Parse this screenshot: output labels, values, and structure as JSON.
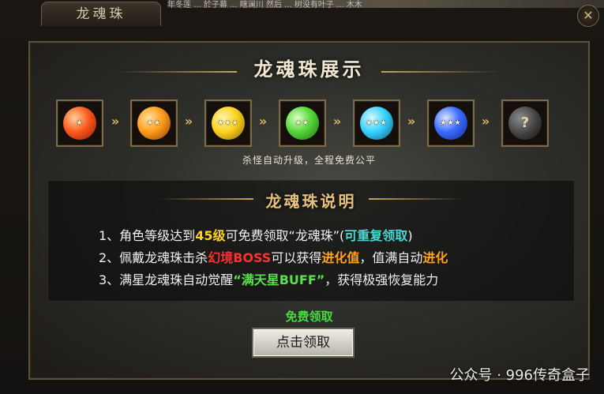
{
  "window": {
    "title": "龙魂珠"
  },
  "top_strip": {
    "text": "年冬莲 ... 於子幕 ... 瞎澜川 然后 ... 树没有叶子 ... 木木"
  },
  "showcase": {
    "title": "龙魂珠展示",
    "caption": "杀怪自动升级，全程免费公平",
    "orbs": [
      {
        "name": "red-orb-icon",
        "color": "#ff5a1f"
      },
      {
        "name": "orange-orb-icon",
        "color": "#ff9d1a"
      },
      {
        "name": "yellow-orb-icon",
        "color": "#ffd21f"
      },
      {
        "name": "green-orb-icon",
        "color": "#56d839"
      },
      {
        "name": "cyan-orb-icon",
        "color": "#38d3ff"
      },
      {
        "name": "blue-orb-icon",
        "color": "#3b6bff"
      },
      {
        "name": "unknown-orb-icon",
        "color": "#4a4a4a",
        "label": "?"
      }
    ]
  },
  "description": {
    "title": "龙魂珠说明",
    "line1": {
      "a": "1、角色等级达到",
      "b": "45级",
      "c": "可免费领取“龙魂珠”(",
      "d": "可重复领取",
      "e": ")"
    },
    "line2": {
      "a": "2、佩戴龙魂珠击杀",
      "b": "幻境BOSS",
      "c": "可以获得",
      "d": "进化值",
      "e": "，值满自动",
      "f": "进化"
    },
    "line3": {
      "a": "3、满星龙魂珠自动觉醒",
      "b": "“满天星BUFF”",
      "c": "，获得极强恢复能力"
    }
  },
  "free": {
    "text": "免费领取"
  },
  "claim_button": {
    "label": "点击领取"
  },
  "watermark": {
    "text": "公众号 · 996传奇盒子"
  },
  "colors": {
    "yellow": "#ffd028",
    "cyan": "#49d6d3",
    "red": "#ff2f2f",
    "orange": "#ffa31a",
    "green": "#57e14d"
  }
}
